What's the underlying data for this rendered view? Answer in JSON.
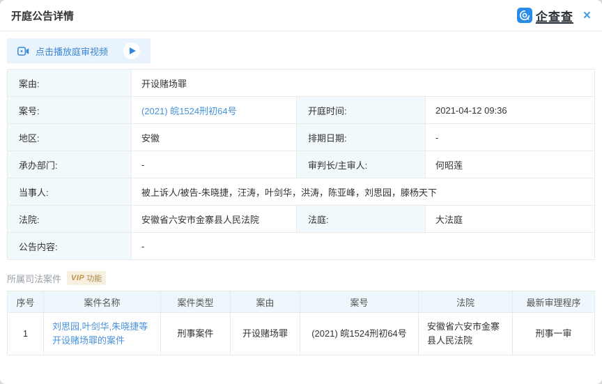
{
  "header": {
    "title": "开庭公告详情",
    "brand": "企查查",
    "logo_glyph": "企",
    "close_label": "×"
  },
  "video_banner": {
    "label": "点击播放庭审视频"
  },
  "details": {
    "case_reason_label": "案由:",
    "case_reason": "开设赌场罪",
    "case_no_label": "案号:",
    "case_no": "(2021) 皖1524刑初64号",
    "hearing_time_label": "开庭时间:",
    "hearing_time": "2021-04-12 09:36",
    "region_label": "地区:",
    "region": "安徽",
    "schedule_date_label": "排期日期:",
    "schedule_date": "-",
    "department_label": "承办部门:",
    "department": "-",
    "judge_label": "审判长/主审人:",
    "judge": "何昭莲",
    "parties_label": "当事人:",
    "parties": "被上诉人/被告-朱晓捷，汪涛，叶剑华，洪涛，陈亚峰，刘思园，滕杨天下",
    "court_label": "法院:",
    "court": "安徽省六安市金寨县人民法院",
    "courtroom_label": "法庭:",
    "courtroom": "大法庭",
    "content_label": "公告内容:",
    "content": "-"
  },
  "related_section": {
    "title": "所属司法案件",
    "vip_badge": {
      "vip": "VIP",
      "text": "功能"
    }
  },
  "case_table": {
    "headers": [
      "序号",
      "案件名称",
      "案件类型",
      "案由",
      "案号",
      "法院",
      "最新审理程序"
    ],
    "rows": [
      {
        "index": "1",
        "name": "刘思园,叶剑华,朱晓捷等开设赌场罪的案件",
        "type": "刑事案件",
        "reason": "开设赌场罪",
        "number": "(2021) 皖1524刑初64号",
        "court": "安徽省六安市金寨县人民法院",
        "latest_procedure": "刑事一审"
      }
    ]
  },
  "colors": {
    "accent": "#2b8ce8",
    "link": "#4792db",
    "label_bg": "#f2f9fd",
    "table_header_bg": "#eef7fc",
    "banner_bg": "#e9f3fd",
    "vip_bg": "#f7efdf",
    "vip_text": "#b9903f"
  }
}
